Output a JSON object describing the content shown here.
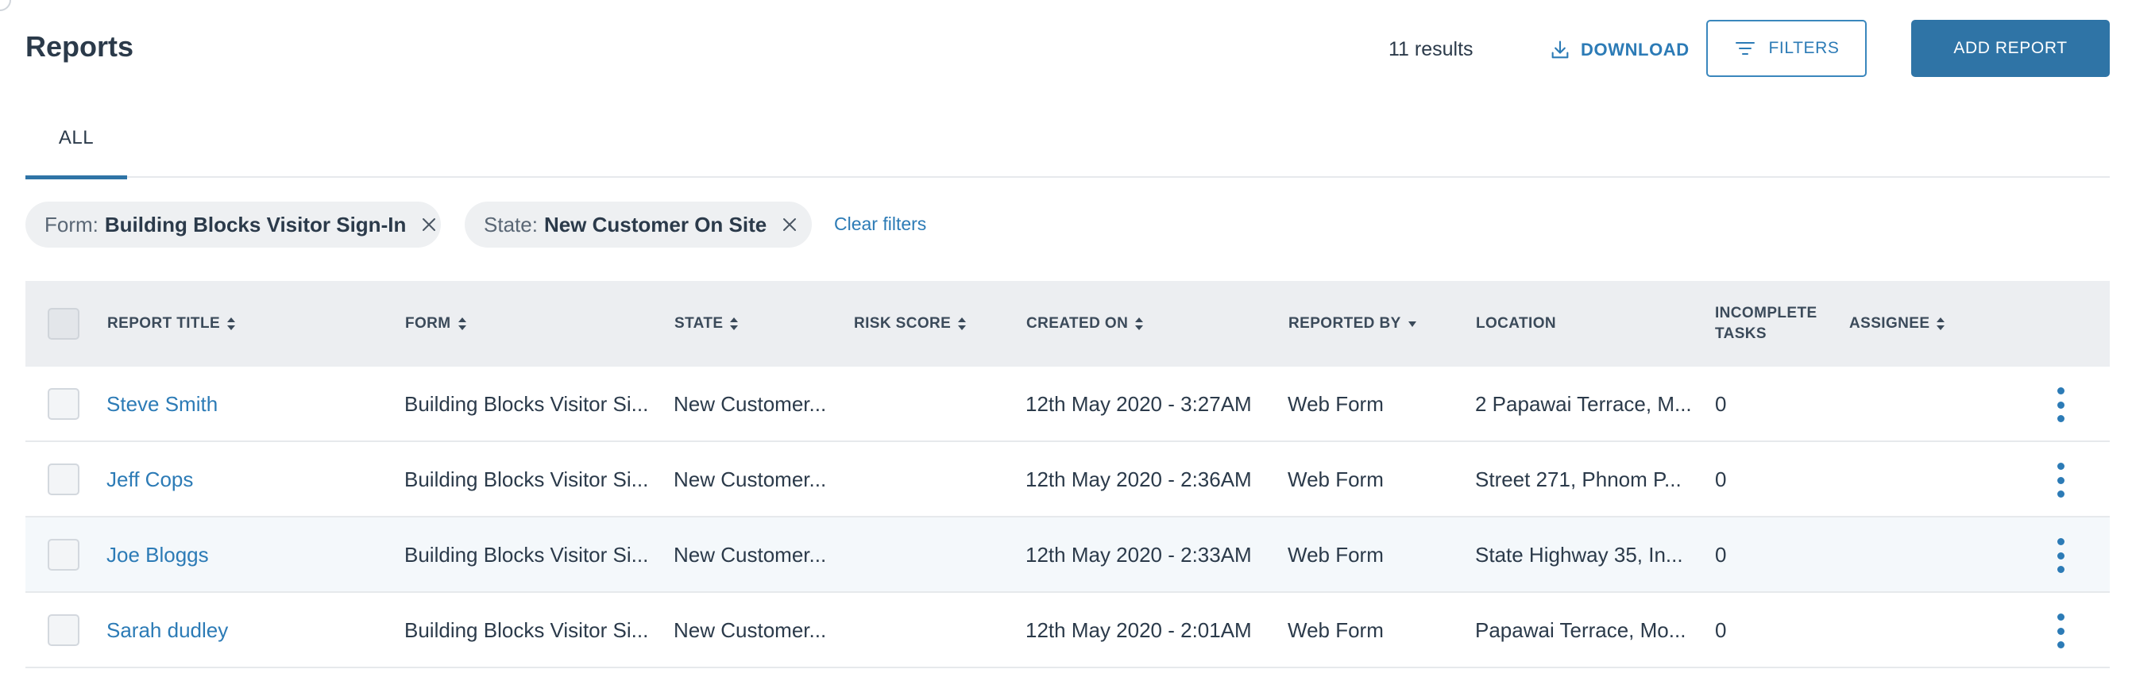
{
  "header": {
    "title": "Reports",
    "results": "11 results",
    "download_label": "DOWNLOAD",
    "filters_label": "FILTERS",
    "add_report_label": "ADD REPORT"
  },
  "tabs": [
    {
      "label": "ALL",
      "active": true
    }
  ],
  "filters": {
    "chips": [
      {
        "key": "Form:",
        "value": "Building Blocks Visitor Sign-In"
      },
      {
        "key": "State:",
        "value": "New Customer On Site"
      }
    ],
    "clear_label": "Clear filters"
  },
  "table": {
    "columns": [
      {
        "label": "REPORT TITLE",
        "sort": "both"
      },
      {
        "label": "FORM",
        "sort": "both"
      },
      {
        "label": "STATE",
        "sort": "both"
      },
      {
        "label": "RISK SCORE",
        "sort": "both"
      },
      {
        "label": "CREATED ON",
        "sort": "both"
      },
      {
        "label": "REPORTED BY",
        "sort": "desc"
      },
      {
        "label": "LOCATION",
        "sort": "none"
      },
      {
        "label": "INCOMPLETE TASKS",
        "sort": "none"
      },
      {
        "label": "ASSIGNEE",
        "sort": "both"
      }
    ],
    "rows": [
      {
        "title": "Steve Smith",
        "form": "Building Blocks Visitor Si...",
        "state": "New Customer...",
        "risk_score": "",
        "created_on": "12th May 2020 - 3:27AM",
        "reported_by": "Web Form",
        "location": "2 Papawai Terrace, M...",
        "incomplete_tasks": "0",
        "assignee": ""
      },
      {
        "title": "Jeff Cops",
        "form": "Building Blocks Visitor Si...",
        "state": "New Customer...",
        "risk_score": "",
        "created_on": "12th May 2020 - 2:36AM",
        "reported_by": "Web Form",
        "location": "Street 271, Phnom P...",
        "incomplete_tasks": "0",
        "assignee": ""
      },
      {
        "title": "Joe Bloggs",
        "form": "Building Blocks Visitor Si...",
        "state": "New Customer...",
        "risk_score": "",
        "created_on": "12th May 2020 - 2:33AM",
        "reported_by": "Web Form",
        "location": "State Highway 35, In...",
        "incomplete_tasks": "0",
        "assignee": ""
      },
      {
        "title": "Sarah dudley",
        "form": "Building Blocks Visitor Si...",
        "state": "New Customer...",
        "risk_score": "",
        "created_on": "12th May 2020 - 2:01AM",
        "reported_by": "Web Form",
        "location": "Papawai Terrace, Mo...",
        "incomplete_tasks": "0",
        "assignee": ""
      }
    ]
  },
  "colors": {
    "accent": "#2c7bb6",
    "primary_button": "#2f74a6",
    "text": "#2b3a4a",
    "header_bg": "#eceef1",
    "chip_bg": "#eef0f2"
  }
}
